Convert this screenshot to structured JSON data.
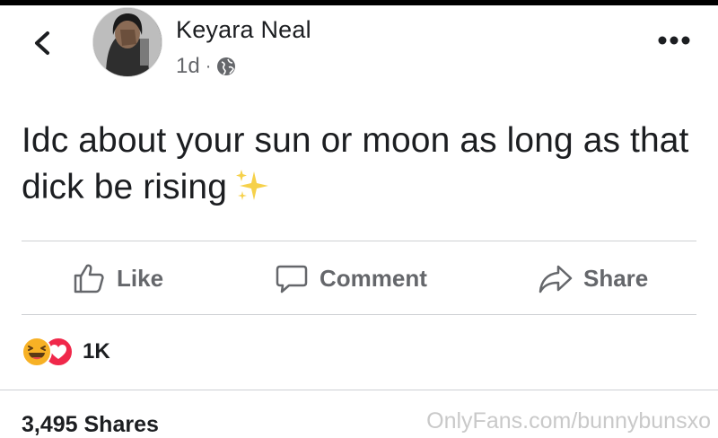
{
  "header": {
    "author_name": "Keyara Neal",
    "timestamp": "1d",
    "separator": "·",
    "privacy_icon": "globe-icon",
    "back_icon": "chevron-left-icon",
    "more_icon": "more-options-icon"
  },
  "post": {
    "text": "Idc about your sun or moon as long as that dick be rising",
    "emoji": "sparkles-emoji"
  },
  "actions": {
    "like_label": "Like",
    "comment_label": "Comment",
    "share_label": "Share"
  },
  "reactions": {
    "types": [
      "haha-reaction-icon",
      "love-reaction-icon"
    ],
    "count": "1K"
  },
  "footer": {
    "shares": "3,495 Shares",
    "watermark": "OnlyFans.com/bunnybunsxo"
  },
  "colors": {
    "text": "#1c1e21",
    "secondary": "#65676b",
    "divider": "#ced0d4",
    "haha": "#f7b125",
    "love": "#f0284a"
  }
}
